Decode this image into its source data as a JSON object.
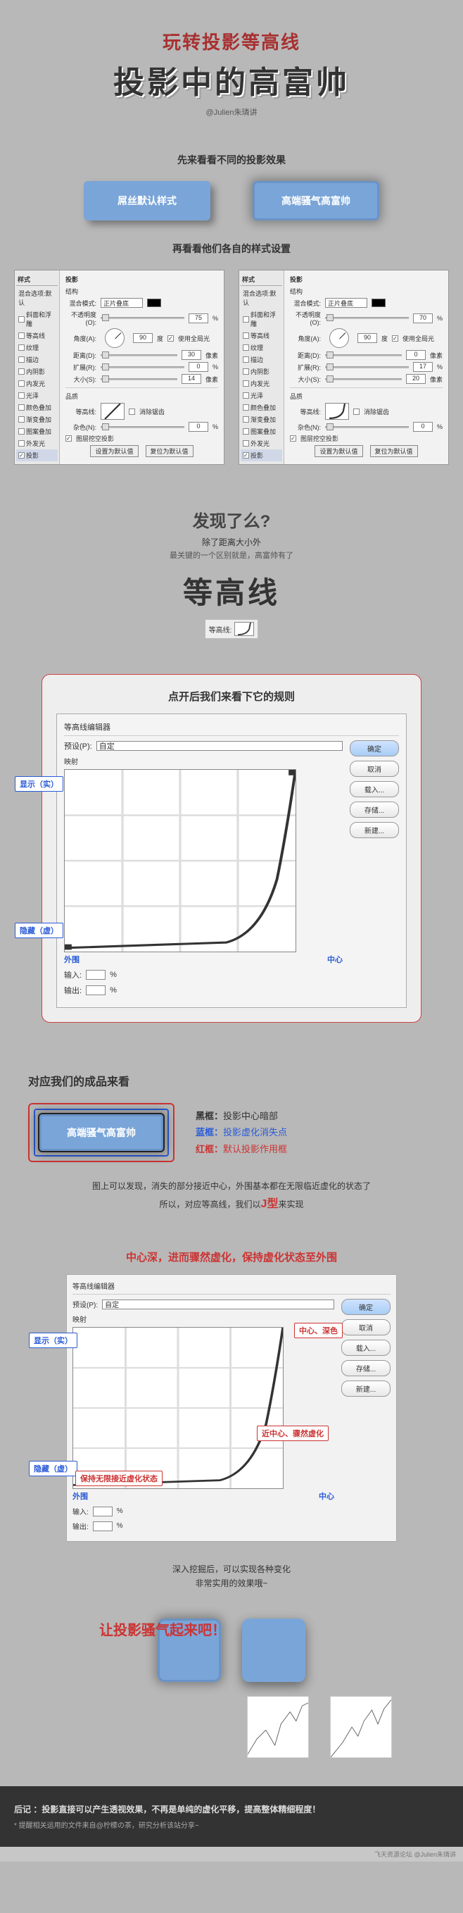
{
  "hero": {
    "pre": "玩转投影等高线",
    "title": "投影中的高富帅",
    "sub": "@Julien朱璘讲"
  },
  "s1": {
    "title": "先来看看不同的投影效果",
    "btn1": "屌丝默认样式",
    "btn2": "高端骚气高富帅"
  },
  "s2": {
    "title": "再看看他们各自的样式设置"
  },
  "panel": {
    "sideTitle": "样式",
    "items": [
      "混合选项:默认",
      "斜面和浮雕",
      "等高线",
      "纹理",
      "描边",
      "内阴影",
      "内发光",
      "光泽",
      "颜色叠加",
      "渐变叠加",
      "图案叠加",
      "外发光",
      "投影"
    ],
    "bodyTitle": "投影",
    "struct": "结构",
    "blendMode": "混合模式:",
    "blendVal": "正片叠底",
    "opacity": "不透明度(O):",
    "op1": "75",
    "op2": "70",
    "angle": "角度(A):",
    "ang1": "90",
    "ang2": "90",
    "global": "使用全局光",
    "dist": "距离(D):",
    "d1": "30",
    "d2": "0",
    "spread": "扩展(R):",
    "sp1": "0",
    "sp2": "17",
    "size": "大小(S):",
    "sz1": "14",
    "sz2": "20",
    "quality": "品质",
    "contour": "等高线:",
    "anti": "消除锯齿",
    "noise": "杂色(N):",
    "noiseVal": "0",
    "knockout": "图层挖空投影",
    "btnDefault": "设置为默认值",
    "btnReset": "复位为默认值",
    "px": "像素",
    "pct": "%",
    "deg": "度"
  },
  "found": {
    "q": "发现了么?",
    "sub": "除了距离大小外",
    "small": "最关键的一个区别就是，高富帅有了",
    "big": "等高线",
    "inline": "等高线:"
  },
  "editor": {
    "wrapTitle": "点开后我们来看下它的规则",
    "title": "等高线编辑器",
    "preset": "预设(P):",
    "presetVal": "自定",
    "mapping": "映射",
    "ok": "确定",
    "cancel": "取消",
    "load": "载入...",
    "save": "存储...",
    "new": "新建...",
    "input": "输入:",
    "output": "输出:",
    "pct": "%",
    "tagShow": "显示（实）",
    "tagHide": "隐藏（虚）",
    "outer": "外围",
    "center": "中心"
  },
  "prod": {
    "h": "对应我们的成品来看",
    "btn": "高端骚气高富帅",
    "l1a": "黑框：",
    "l1b": "投影中心暗部",
    "l2a": "蓝框：",
    "l2b": "投影虚化消失点",
    "l3a": "红框：",
    "l3b": "默认投影作用框",
    "note1": "图上可以发现，消失的部分接近中心，外围基本都在无限临近虚化的状态了",
    "note2a": "所以，对应等高线，我们以",
    "note2b": "J型",
    "note2c": "来实现"
  },
  "red": "中心深，进而骤然虚化，保持虚化状态至外围",
  "e2": {
    "t1": "中心、深色",
    "t2": "近中心、骤然虚化",
    "t3": "保持无限接近虚化状态"
  },
  "deep": {
    "l1": "深入挖掘后，可以实现各种变化",
    "l2": "非常实用的效果哦~"
  },
  "cta": "让投影骚气起来吧！",
  "footer": {
    "main": "后记 ：投影直接可以产生透视效果，不再是单纯的虚化平移，提高整体精细程度！",
    "sub": "* 提醒相关运用的文件来自@柠檬の茶，研究分析该站分享~"
  },
  "watermark": "飞天资源论坛 @Julien朱璘讲",
  "chart_data": [
    {
      "type": "line",
      "title": "J型等高线",
      "x": [
        0,
        70,
        85,
        92,
        96,
        100
      ],
      "y": [
        2,
        5,
        15,
        40,
        75,
        100
      ],
      "xlabel": "外围→中心",
      "ylabel": "隐藏→显示",
      "xlim": [
        0,
        100
      ],
      "ylim": [
        0,
        100
      ]
    },
    {
      "type": "line",
      "title": "多峰等高线A",
      "x": [
        0,
        15,
        30,
        45,
        55,
        70,
        80,
        90,
        100
      ],
      "y": [
        5,
        30,
        45,
        20,
        55,
        75,
        60,
        85,
        90
      ],
      "xlim": [
        0,
        100
      ],
      "ylim": [
        0,
        100
      ]
    },
    {
      "type": "line",
      "title": "多峰等高线B",
      "x": [
        0,
        20,
        35,
        45,
        55,
        68,
        78,
        88,
        100
      ],
      "y": [
        0,
        25,
        50,
        35,
        60,
        78,
        55,
        80,
        95
      ],
      "xlim": [
        0,
        100
      ],
      "ylim": [
        0,
        100
      ]
    }
  ]
}
